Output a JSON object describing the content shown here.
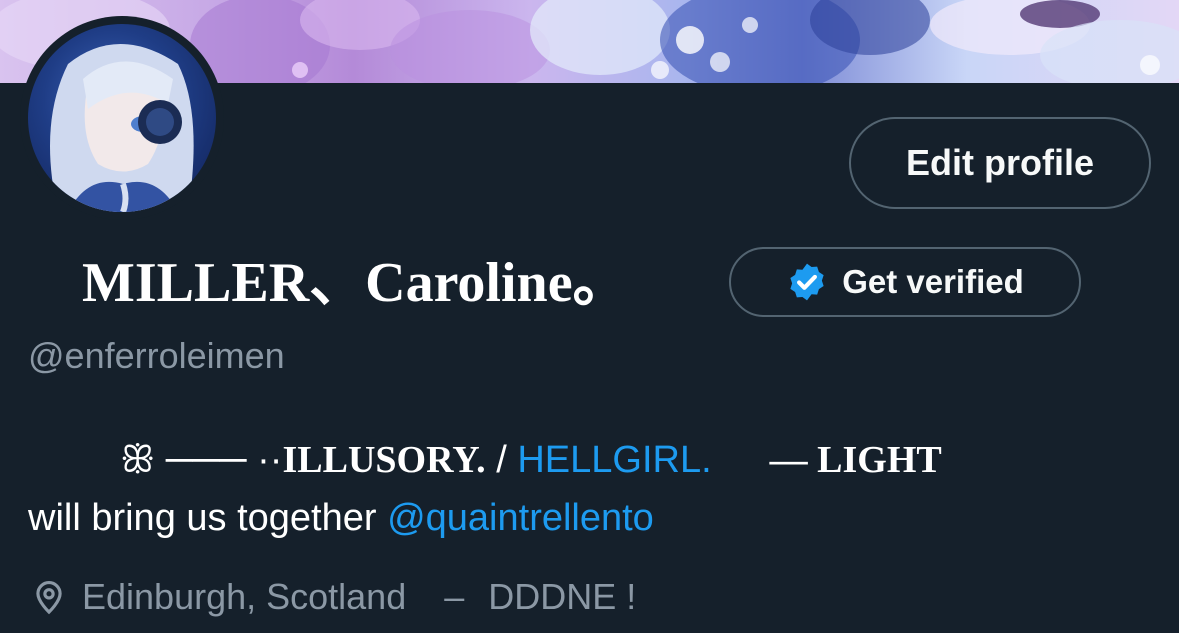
{
  "profile": {
    "display_name": "MILLER、Caroline。",
    "handle": "@enferroleimen",
    "edit_profile_label": "Edit profile",
    "get_verified_label": "Get verified"
  },
  "bio": {
    "ornament": "ꕥ ─── ·· ",
    "illusory": "ILLUSORY.",
    "slash": " / ",
    "hellgirl": "HELLGIRL.",
    "dash_light": "— LIGHT",
    "line2_text": "will bring us together ",
    "mention": "@quaintrellento"
  },
  "location": {
    "text": "Edinburgh, Scotland",
    "separator": "–",
    "extra": "DDDNE !"
  },
  "colors": {
    "background": "#15202b",
    "link": "#1d9bf0",
    "muted": "#8b98a5",
    "border": "#536471",
    "verified": "#1d9bf0"
  }
}
